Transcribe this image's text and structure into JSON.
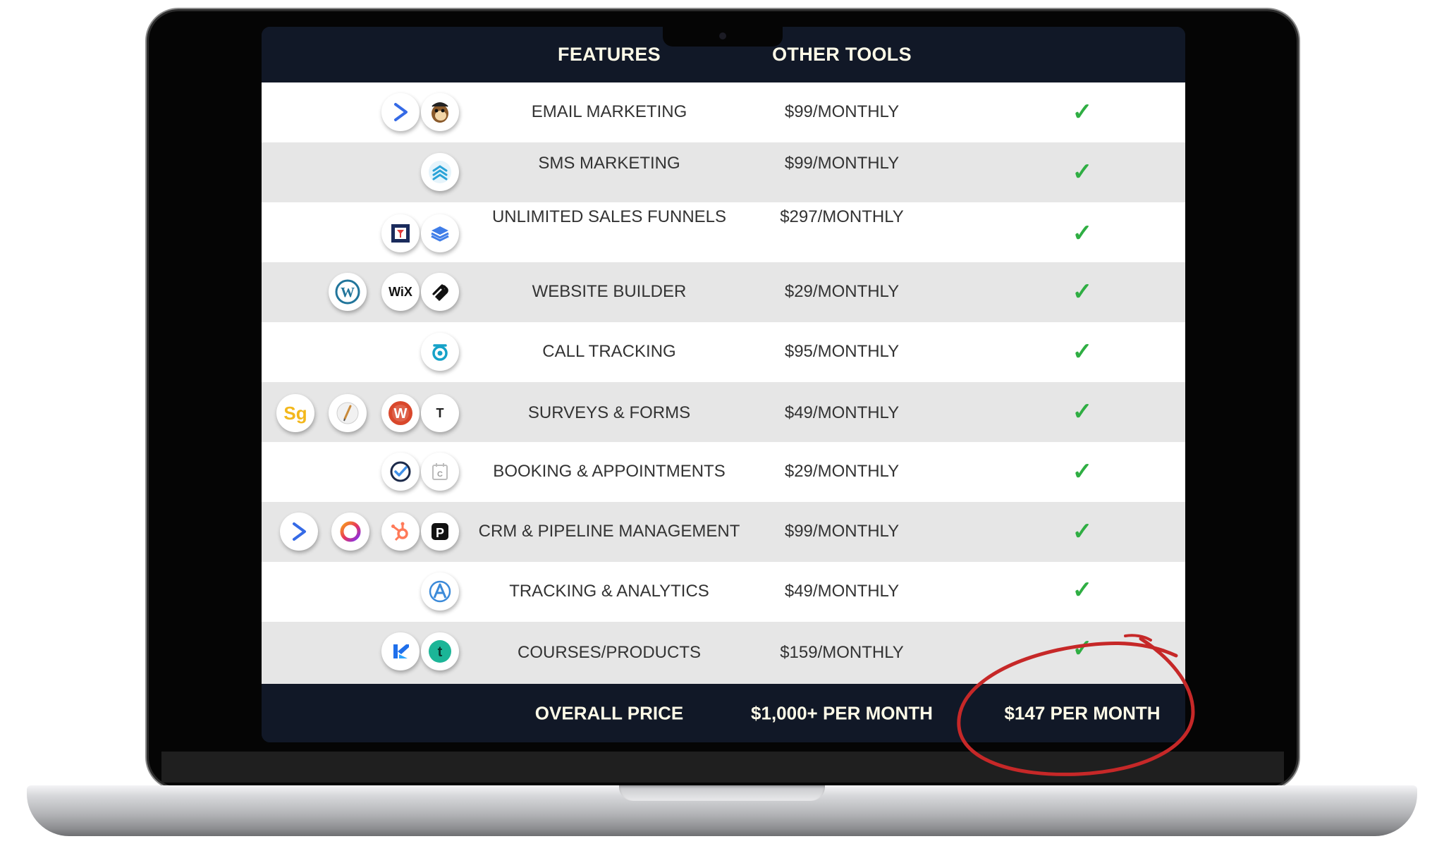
{
  "table": {
    "header": {
      "features": "FEATURES",
      "other_tools": "OTHER TOOLS"
    },
    "rows": [
      {
        "feature": "EMAIL MARKETING",
        "price": "$99/MONTHLY",
        "icons": [
          "activecampaign-icon",
          "mailchimp-icon"
        ]
      },
      {
        "feature": "SMS MARKETING",
        "price": "$99/MONTHLY",
        "icons": [
          "sms-stack-icon"
        ]
      },
      {
        "feature": "UNLIMITED SALES FUNNELS",
        "price": "$297/MONTHLY",
        "icons": [
          "clickfunnels-icon",
          "layers-icon"
        ]
      },
      {
        "feature": "WEBSITE BUILDER",
        "price": "$29/MONTHLY",
        "icons": [
          "wordpress-icon",
          "wix-icon",
          "squarespace-icon"
        ]
      },
      {
        "feature": "CALL TRACKING",
        "price": "$95/MONTHLY",
        "icons": [
          "callrail-icon"
        ]
      },
      {
        "feature": "SURVEYS & FORMS",
        "price": "$49/MONTHLY",
        "icons": [
          "surveygizmo-icon",
          "quill-icon",
          "wufoo-icon",
          "typeform-icon"
        ]
      },
      {
        "feature": "BOOKING & APPOINTMENTS",
        "price": "$29/MONTHLY",
        "icons": [
          "acuity-check-icon",
          "calendly-icon"
        ]
      },
      {
        "feature": "CRM & PIPELINE MANAGEMENT",
        "price": "$99/MONTHLY",
        "icons": [
          "activecampaign-icon",
          "ring-icon",
          "hubspot-icon",
          "pipedrive-icon"
        ]
      },
      {
        "feature": "TRACKING & ANALYTICS",
        "price": "$49/MONTHLY",
        "icons": [
          "analytics-a-icon"
        ]
      },
      {
        "feature": "COURSES/PRODUCTS",
        "price": "$159/MONTHLY",
        "icons": [
          "kajabi-icon",
          "teachable-icon"
        ]
      }
    ],
    "footer": {
      "label": "OVERALL PRICE",
      "other_tools_total": "$1,000+ PER MONTH",
      "our_price": "$147 PER MONTH"
    },
    "icon_letters": {
      "wix": "WiX",
      "surveygizmo": "Sg",
      "typeform": "T",
      "pipedrive": "P",
      "teachable": "t",
      "wordpress": "W",
      "wufoo": "W",
      "calendly": "C"
    }
  },
  "colors": {
    "header_bg": "#111827",
    "header_text": "#fffbe8",
    "row_alt": "#e6e6e6",
    "check": "#2fae43",
    "annotation": "#c62828"
  }
}
